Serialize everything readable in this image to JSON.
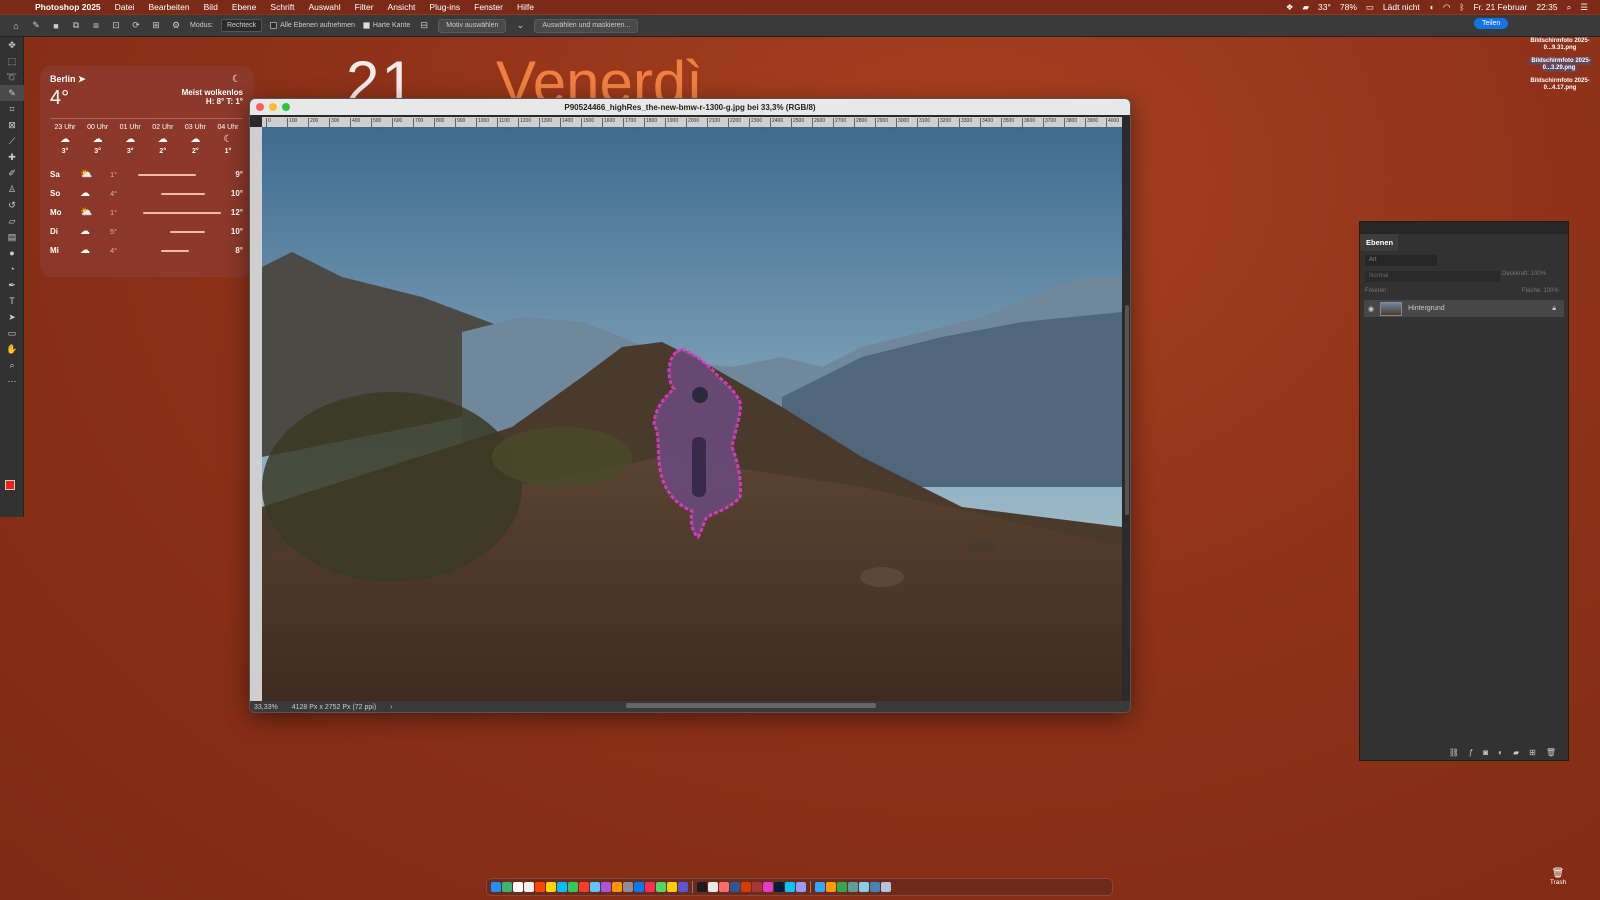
{
  "menubar": {
    "app_name": "Photoshop 2025",
    "items": [
      "Datei",
      "Bearbeiten",
      "Bild",
      "Ebene",
      "Schrift",
      "Auswahl",
      "Filter",
      "Ansicht",
      "Plug-ins",
      "Fenster",
      "Hilfe"
    ],
    "temperature": "33°",
    "battery": "78%",
    "charging": "Lädt nicht",
    "date": "Fr. 21 Februar",
    "time": "22:35"
  },
  "options_bar": {
    "mode_label": "Modus:",
    "mode_value": "Rechteck",
    "all_layers_label": "Alle Ebenen aufnehmen",
    "hard_edge_label": "Harte Kante",
    "select_subject_label": "Motiv auswählen",
    "select_mask_label": "Auswählen und maskieren...",
    "share_label": "Teilen"
  },
  "weather": {
    "city": "Berlin",
    "temp": "4°",
    "condition": "Meist wolkenlos",
    "hilo": "H: 8° T: 1°",
    "hours": [
      {
        "time": "23 Uhr",
        "temp": "3°",
        "icon": "cloud-moon-icon"
      },
      {
        "time": "00 Uhr",
        "temp": "3°",
        "icon": "cloud-moon-icon"
      },
      {
        "time": "01 Uhr",
        "temp": "3°",
        "icon": "cloud-icon"
      },
      {
        "time": "02 Uhr",
        "temp": "2°",
        "icon": "cloud-moon-icon"
      },
      {
        "time": "03 Uhr",
        "temp": "2°",
        "icon": "cloud-moon-icon"
      },
      {
        "time": "04 Uhr",
        "temp": "1°",
        "icon": "moon-icon"
      }
    ],
    "days": [
      {
        "day": "Sa",
        "lo": "1°",
        "hi": "9°",
        "icon": "sun-cloud-icon",
        "bar_start": 0.05,
        "bar_end": 0.7
      },
      {
        "day": "So",
        "lo": "4°",
        "hi": "10°",
        "icon": "cloud-icon",
        "bar_start": 0.3,
        "bar_end": 0.8
      },
      {
        "day": "Mo",
        "lo": "1°",
        "hi": "12°",
        "icon": "sun-cloud-icon",
        "bar_start": 0.1,
        "bar_end": 0.98
      },
      {
        "day": "Di",
        "lo": "5°",
        "hi": "10°",
        "icon": "cloud-icon",
        "bar_start": 0.4,
        "bar_end": 0.8
      },
      {
        "day": "Mi",
        "lo": "4°",
        "hi": "8°",
        "icon": "cloud-icon",
        "bar_start": 0.3,
        "bar_end": 0.62
      }
    ]
  },
  "desktop_clock": {
    "date_num": "21",
    "day_name": "Venerdì"
  },
  "document": {
    "title": "P90524466_highRes_the-new-bmw-r-1300-g.jpg bei 33,3% (RGB/8)",
    "ruler_ticks": [
      "0",
      "100",
      "200",
      "300",
      "400",
      "500",
      "600",
      "700",
      "800",
      "900",
      "1000",
      "1100",
      "1200",
      "1300",
      "1400",
      "1500",
      "1600",
      "1700",
      "1800",
      "1900",
      "2000",
      "2100",
      "2200",
      "2300",
      "2400",
      "2500",
      "2600",
      "2700",
      "2800",
      "2900",
      "3000",
      "3100",
      "3200",
      "3300",
      "3400",
      "3500",
      "3600",
      "3700",
      "3800",
      "3900",
      "4000"
    ],
    "zoom": "33,33%",
    "dimensions": "4128 Px x 2752 Px (72 ppi)"
  },
  "layers_panel": {
    "tab_label": "Ebenen",
    "search_placeholder": "Art",
    "blend_mode": "Normal",
    "opacity_label": "Deckkraft:",
    "opacity_value": "100%",
    "lock_label": "Fixieren:",
    "fill_label": "Fläche:",
    "fill_value": "100%",
    "layers": [
      {
        "name": "Hintergrund",
        "locked": true,
        "visible": true
      }
    ]
  },
  "desktop_files": [
    {
      "name": "Bildschirmfoto 2025-0...9.31.png",
      "selected": false
    },
    {
      "name": "Bildschirmfoto 2025-0...3.29.png",
      "selected": true
    },
    {
      "name": "Bildschirmfoto 2025-0...4.17.png",
      "selected": false
    }
  ],
  "dock": {
    "trash_label": "Trash"
  },
  "colors": {
    "accent": "#1473e6",
    "selection": "#e03cc8",
    "foreground": "#e8251a",
    "background_swatch": "#111111"
  }
}
